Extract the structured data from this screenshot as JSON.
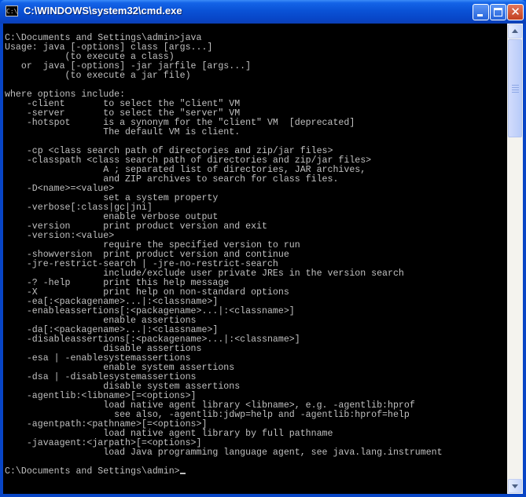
{
  "window": {
    "title": "C:\\WINDOWS\\system32\\cmd.exe",
    "icon": "cmd-icon",
    "icon_glyph": "C:\\",
    "controls": {
      "minimize": "minimize-icon",
      "maximize": "maximize-icon",
      "close_glyph": "✕"
    }
  },
  "console": {
    "output": "C:\\Documents and Settings\\admin>java\nUsage: java [-options] class [args...]\n           (to execute a class)\n   or  java [-options] -jar jarfile [args...]\n           (to execute a jar file)\n\nwhere options include:\n    -client       to select the \"client\" VM\n    -server       to select the \"server\" VM\n    -hotspot      is a synonym for the \"client\" VM  [deprecated]\n                  The default VM is client.\n\n    -cp <class search path of directories and zip/jar files>\n    -classpath <class search path of directories and zip/jar files>\n                  A ; separated list of directories, JAR archives,\n                  and ZIP archives to search for class files.\n    -D<name>=<value>\n                  set a system property\n    -verbose[:class|gc|jni]\n                  enable verbose output\n    -version      print product version and exit\n    -version:<value>\n                  require the specified version to run\n    -showversion  print product version and continue\n    -jre-restrict-search | -jre-no-restrict-search\n                  include/exclude user private JREs in the version search\n    -? -help      print this help message\n    -X            print help on non-standard options\n    -ea[:<packagename>...|:<classname>]\n    -enableassertions[:<packagename>...|:<classname>]\n                  enable assertions\n    -da[:<packagename>...|:<classname>]\n    -disableassertions[:<packagename>...|:<classname>]\n                  disable assertions\n    -esa | -enablesystemassertions\n                  enable system assertions\n    -dsa | -disablesystemassertions\n                  disable system assertions\n    -agentlib:<libname>[=<options>]\n                  load native agent library <libname>, e.g. -agentlib:hprof\n                    see also, -agentlib:jdwp=help and -agentlib:hprof=help\n    -agentpath:<pathname>[=<options>]\n                  load native agent library by full pathname\n    -javaagent:<jarpath>[=<options>]\n                  load Java programming language agent, see java.lang.instrument\n\n",
    "prompt": "C:\\Documents and Settings\\admin>"
  },
  "colors": {
    "console_bg": "#000000",
    "console_text": "#c0c0c0",
    "titlebar": "#0a52d6",
    "close_button": "#c3401f"
  }
}
